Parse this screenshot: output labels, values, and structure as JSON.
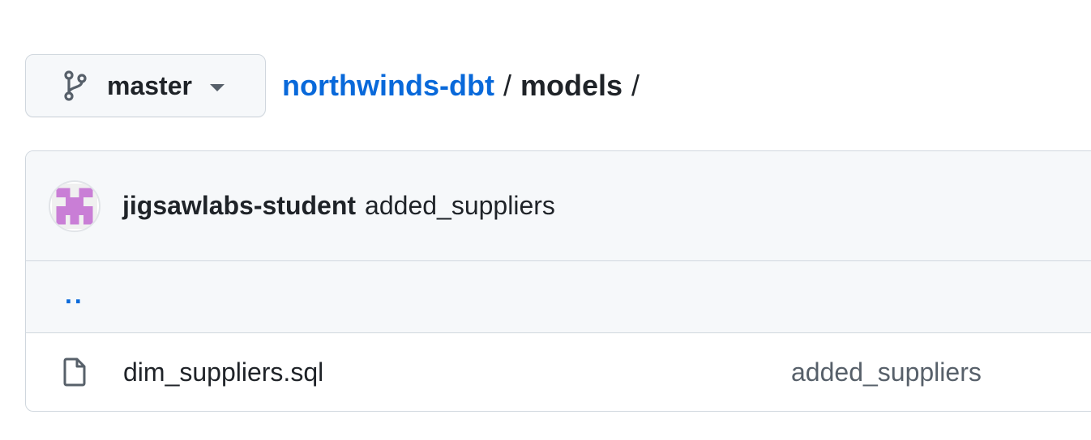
{
  "branch": {
    "label": "master",
    "icon": "git-branch-icon",
    "caret_icon": "triangle-down-icon"
  },
  "breadcrumb": {
    "repo": "northwinds-dbt",
    "separator": "/",
    "current": "models",
    "trailing_separator": "/"
  },
  "latest_commit": {
    "author": "jigsawlabs-student",
    "message": "added_suppliers",
    "avatar_color": "#c97ed6"
  },
  "parent_directory": {
    "label": ".."
  },
  "files": [
    {
      "name": "dim_suppliers.sql",
      "icon": "file-icon",
      "last_commit_message": "added_suppliers"
    }
  ],
  "colors": {
    "link": "#0969da",
    "text": "#1f2328",
    "muted": "#57606a",
    "border": "#d0d7de",
    "header_bg": "#f6f8fa"
  }
}
